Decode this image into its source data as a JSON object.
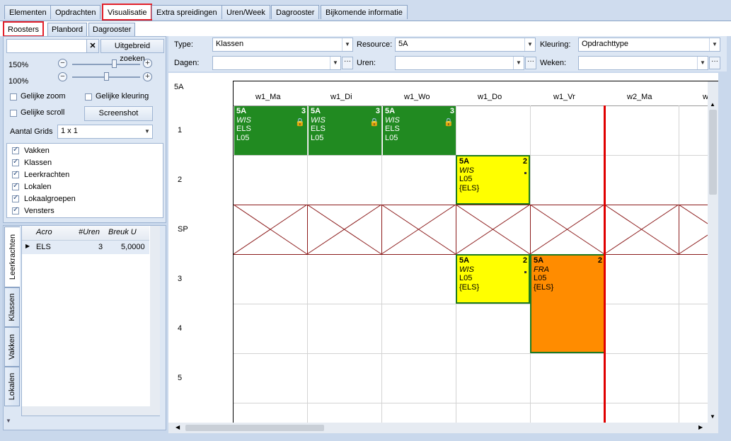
{
  "top_tabs": [
    "Elementen",
    "Opdrachten",
    "Visualisatie",
    "Extra spreidingen",
    "Uren/Week",
    "Dagrooster",
    "Bijkomende informatie"
  ],
  "sub_tabs": [
    "Roosters",
    "Planbord",
    "Dagrooster"
  ],
  "left": {
    "search_value": "",
    "clear_icon": "x-icon",
    "search_button": "Uitgebreid zoeken",
    "zoom1": "150%",
    "zoom2": "100%",
    "zoom1_level": 0.62,
    "zoom2_level": 0.5,
    "equal_zoom": "Gelijke zoom",
    "equal_color": "Gelijke kleuring",
    "equal_scroll": "Gelijke scroll",
    "screenshot_button": "Screenshot",
    "grids_label": "Aantal Grids",
    "grids_value": "1 x 1",
    "checklist": [
      "Vakken",
      "Klassen",
      "Leerkrachten",
      "Lokalen",
      "Lokaalgroepen",
      "Vensters"
    ],
    "table_headers": [
      "Acro",
      "#Uren",
      "Breuk U"
    ],
    "table_rows": [
      {
        "acro": "ELS",
        "uren": "3",
        "breuk": "5,0000"
      }
    ],
    "vtabs": [
      "Leerkrachten",
      "Klassen",
      "Vakken",
      "Lokalen"
    ]
  },
  "filters": {
    "type_label": "Type:",
    "type_value": "Klassen",
    "resource_label": "Resource:",
    "resource_value": "5A",
    "kleuring_label": "Kleuring:",
    "kleuring_value": "Opdrachttype",
    "dagen_label": "Dagen:",
    "dagen_value": "",
    "uren_label": "Uren:",
    "uren_value": "",
    "weken_label": "Weken:",
    "weken_value": "",
    "dots": "···"
  },
  "schedule": {
    "corner": "5A",
    "days": [
      "w1_Ma",
      "w1_Di",
      "w1_Wo",
      "w1_Do",
      "w1_Vr",
      "w2_Ma",
      "w"
    ],
    "rows": [
      "1",
      "2",
      "SP",
      "3",
      "4",
      "5"
    ],
    "colors": {
      "green": "#218a21",
      "yellow": "#ffff00",
      "orange": "#ff8c00",
      "today": "#e00000",
      "pause": "#8b1a1a"
    },
    "blocks": [
      {
        "l1": "5A",
        "l2": "WIS",
        "l3": "ELS",
        "l4": "L05",
        "n": "3",
        "icon": "lock-icon"
      },
      {
        "l1": "5A",
        "l2": "WIS",
        "l3": "ELS",
        "l4": "L05",
        "n": "3",
        "icon": "lock-icon"
      },
      {
        "l1": "5A",
        "l2": "WIS",
        "l3": "ELS",
        "l4": "L05",
        "n": "3",
        "icon": "lock-icon"
      },
      {
        "l1": "5A",
        "l2": "WIS",
        "l3": "L05",
        "l4": "{ELS}",
        "n": "2"
      },
      {
        "l1": "5A",
        "l2": "WIS",
        "l3": "L05",
        "l4": "{ELS}",
        "n": "2"
      },
      {
        "l1": "5A",
        "l2": "FRA",
        "l3": "L05",
        "l4": "{ELS}",
        "n": "2"
      }
    ]
  }
}
